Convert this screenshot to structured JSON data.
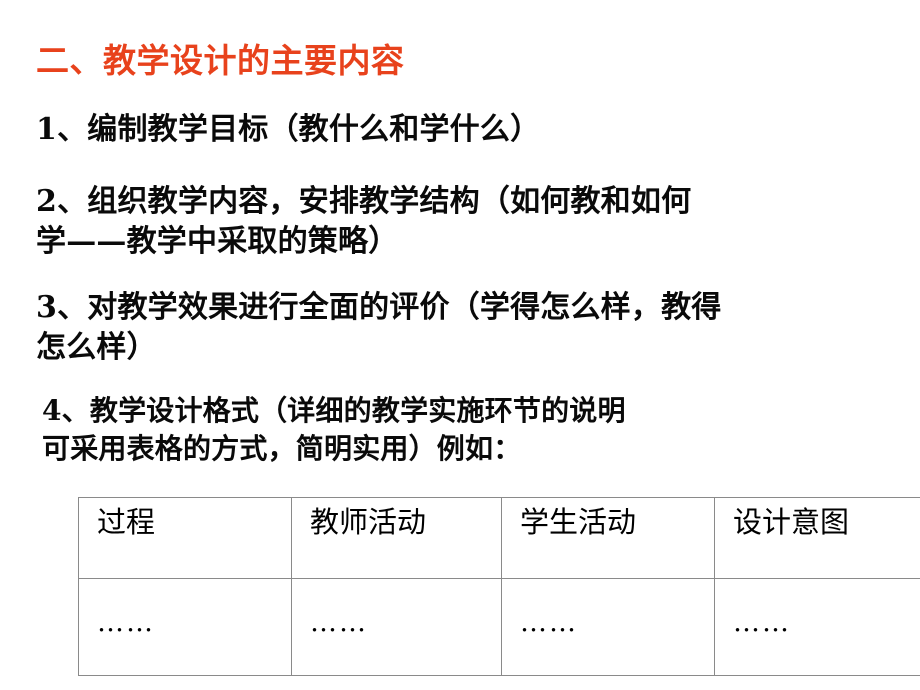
{
  "slide": {
    "title": "二、教学设计的主要内容",
    "title_color": "#e8421c",
    "body_color": "#0a0a0a",
    "background_color": "#ffffff",
    "items": [
      {
        "id": "item-1",
        "lines": [
          "1、编制教学目标（教什么和学什么）"
        ]
      },
      {
        "id": "item-2",
        "lines": [
          "2、组织教学内容，安排教学结构（如何教和如何",
          "学——教学中采取的策略）"
        ]
      },
      {
        "id": "item-3",
        "lines": [
          "3、对教学效果进行全面的评价（学得怎么样，教得",
          "怎么样）"
        ]
      },
      {
        "id": "item-4",
        "lines": [
          "4、教学设计格式（详细的教学实施环节的说明",
          "可采用表格的方式，简明实用）例如："
        ]
      }
    ]
  },
  "table": {
    "border_color": "#8a8a8a",
    "headers": [
      "过程",
      "教师活动",
      "学生活动",
      "设计意图"
    ],
    "rows": [
      [
        "……",
        "……",
        "……",
        "……"
      ]
    ]
  }
}
